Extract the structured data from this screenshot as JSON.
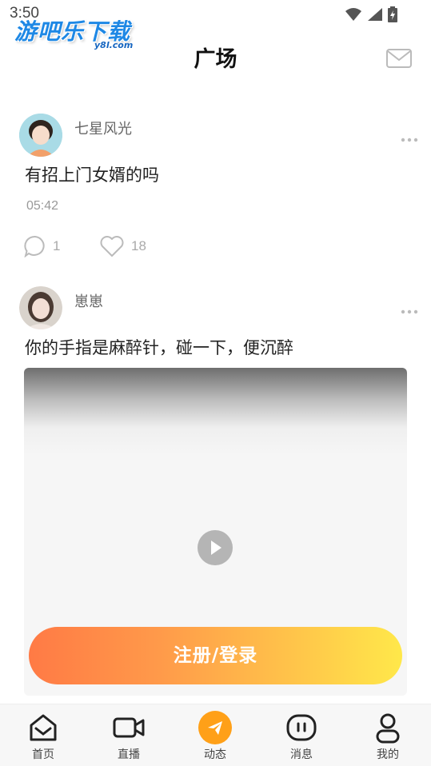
{
  "status_bar": {
    "time": "3:50"
  },
  "watermark": {
    "main": "游吧乐下载",
    "sub": "y8l.com"
  },
  "header": {
    "title": "广场"
  },
  "posts": [
    {
      "username": "七星风光",
      "text": "有招上门女婿的吗",
      "time": "05:42",
      "comments": "1",
      "likes": "18"
    },
    {
      "username": "崽崽",
      "text": "你的手指是麻醉针，碰一下，便沉醉"
    }
  ],
  "login_button": {
    "label": "注册/登录"
  },
  "bottom_nav": {
    "items": [
      {
        "label": "首页",
        "icon": "home-icon"
      },
      {
        "label": "直播",
        "icon": "video-camera-icon"
      },
      {
        "label": "动态",
        "icon": "paper-plane-icon"
      },
      {
        "label": "消息",
        "icon": "message-icon"
      },
      {
        "label": "我的",
        "icon": "user-icon"
      }
    ],
    "active": "动态"
  },
  "colors": {
    "accent": "#ffa018",
    "login_gradient_start": "#ff7a45",
    "login_gradient_end": "#ffe84a",
    "watermark_blue": "#1e88e5"
  }
}
